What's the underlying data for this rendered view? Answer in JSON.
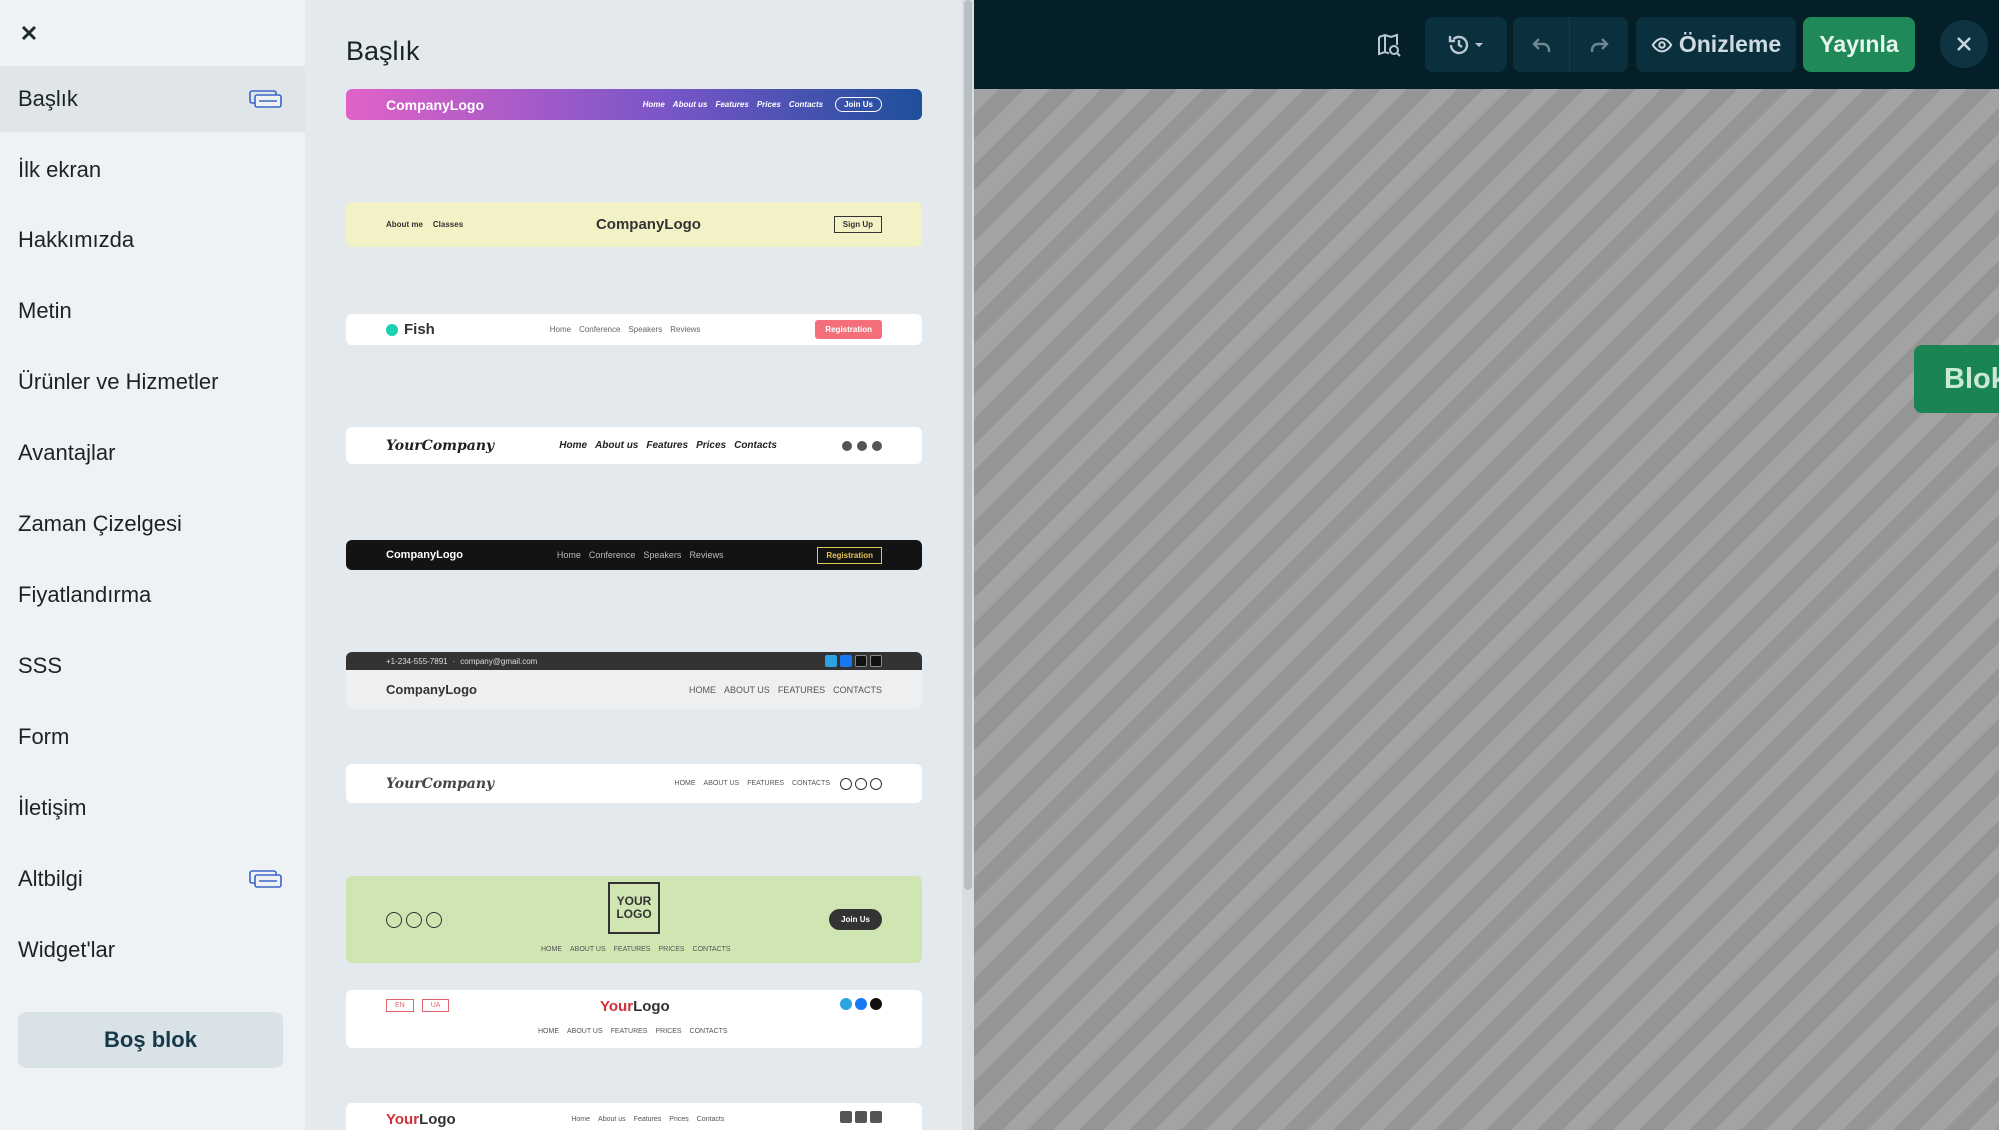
{
  "topbar": {
    "preview_label": "Önizleme",
    "publish_label": "Yayınla"
  },
  "canvas": {
    "add_block_label": "Blok ekle"
  },
  "sidebar": {
    "items": [
      {
        "label": "Başlık",
        "active": true
      },
      {
        "label": "İlk ekran"
      },
      {
        "label": "Hakkımızda"
      },
      {
        "label": "Metin"
      },
      {
        "label": "Ürünler ve Hizmetler"
      },
      {
        "label": "Avantajlar"
      },
      {
        "label": "Zaman Çizelgesi"
      },
      {
        "label": "Fiyatlandırma"
      },
      {
        "label": "SSS"
      },
      {
        "label": "Form"
      },
      {
        "label": "İletişim"
      },
      {
        "label": "Altbilgi"
      },
      {
        "label": "Widget'lar"
      }
    ],
    "empty_block_label": "Boş blok"
  },
  "panel": {
    "title": "Başlık",
    "templates": [
      {
        "logo": "CompanyLogo",
        "nav": [
          "Home",
          "About us",
          "Features",
          "Prices",
          "Contacts"
        ],
        "cta": "Join Us"
      },
      {
        "left": [
          "About me",
          "Classes"
        ],
        "logo": "CompanyLogo",
        "cta": "Sign Up"
      },
      {
        "logo": "Fish",
        "nav": [
          "Home",
          "Conference",
          "Speakers",
          "Reviews"
        ],
        "cta": "Registration"
      },
      {
        "logo": "YourCompany",
        "nav": [
          "Home",
          "About us",
          "Features",
          "Prices",
          "Contacts"
        ]
      },
      {
        "logo": "CompanyLogo",
        "nav": [
          "Home",
          "Conference",
          "Speakers",
          "Reviews"
        ],
        "cta": "Registration"
      },
      {
        "phone": "+1-234-555-7891",
        "email": "company@gmail.com",
        "logo": "CompanyLogo",
        "nav": [
          "HOME",
          "ABOUT US",
          "FEATURES",
          "CONTACTS"
        ]
      },
      {
        "logo": "YourCompany",
        "nav": [
          "HOME",
          "ABOUT US",
          "FEATURES",
          "CONTACTS"
        ]
      },
      {
        "logo_line1": "YOUR",
        "logo_line2": "LOGO",
        "nav": [
          "HOME",
          "ABOUT US",
          "FEATURES",
          "PRICES",
          "CONTACTS"
        ],
        "cta": "Join Us"
      },
      {
        "lang": [
          "EN",
          "UA"
        ],
        "logo_a": "Your",
        "logo_b": "Logo",
        "nav": [
          "HOME",
          "ABOUT US",
          "FEATURES",
          "PRICES",
          "CONTACTS"
        ]
      },
      {
        "logo_a": "Your",
        "logo_b": "Logo",
        "nav": [
          "Home",
          "About us",
          "Features",
          "Prices",
          "Contacts"
        ]
      }
    ]
  }
}
